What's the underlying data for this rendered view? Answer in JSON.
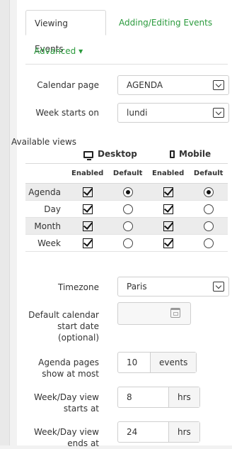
{
  "tabs": [
    {
      "label": "Viewing Events"
    },
    {
      "label": "Adding/Editing Events"
    },
    {
      "label": "Advanced ▾"
    }
  ],
  "settings": {
    "calendar_page": {
      "label": "Calendar page",
      "value": "AGENDA"
    },
    "week_starts_on": {
      "label": "Week starts on",
      "value": "lundi"
    }
  },
  "available_views": {
    "title": "Available views",
    "desktop_label": "Desktop",
    "mobile_label": "Mobile",
    "col_enabled": "Enabled",
    "col_default": "Default",
    "rows": [
      {
        "label": "Agenda",
        "desktop_enabled": true,
        "desktop_default": true,
        "mobile_enabled": true,
        "mobile_default": true
      },
      {
        "label": "Day",
        "desktop_enabled": true,
        "desktop_default": false,
        "mobile_enabled": true,
        "mobile_default": false
      },
      {
        "label": "Month",
        "desktop_enabled": true,
        "desktop_default": false,
        "mobile_enabled": true,
        "mobile_default": false
      },
      {
        "label": "Week",
        "desktop_enabled": true,
        "desktop_default": false,
        "mobile_enabled": true,
        "mobile_default": false
      }
    ]
  },
  "timezone": {
    "label": "Timezone",
    "value": "Paris"
  },
  "default_start": {
    "label_l1": "Default calendar",
    "label_l2": "start date",
    "label_l3": "(optional)",
    "value": ""
  },
  "agenda_pages": {
    "label_l1": "Agenda pages",
    "label_l2": "show at most",
    "value": "10",
    "unit": "events"
  },
  "view_starts": {
    "label_l1": "Week/Day view",
    "label_l2": "starts at",
    "value": "8",
    "unit": "hrs"
  },
  "view_ends": {
    "label_l1": "Week/Day view",
    "label_l2": "ends at",
    "value": "24",
    "unit": "hrs"
  },
  "icons": {
    "desktop": "monitor-icon",
    "mobile": "phone-icon",
    "calendar": "calendar-icon",
    "select": "chevron-down-icon"
  },
  "colors": {
    "tab_link": "#2a9a3c",
    "shade_row": "#ececec"
  }
}
